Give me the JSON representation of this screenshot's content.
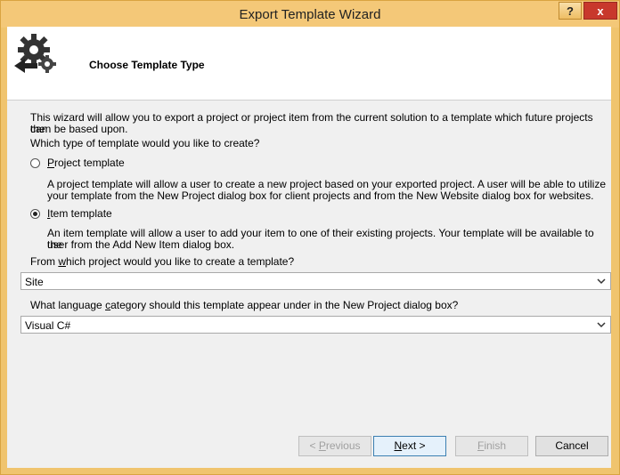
{
  "window": {
    "title": "Export Template Wizard",
    "help_label": "?",
    "close_label": "x"
  },
  "header": {
    "title": "Choose Template Type",
    "icon": "gears-export-icon"
  },
  "intro": {
    "line1": "This wizard will allow you to export a project or project item from the current solution to a template which future projects can",
    "line2": "then be based upon.",
    "question": "Which type of template would you like to create?"
  },
  "project_template": {
    "label_prefix": "",
    "label_accel": "P",
    "label_rest": "roject template",
    "selected": false,
    "desc_line1": "A project template will allow a user to create a new project based on your exported project. A user will be able to utilize",
    "desc_line2": "your template from the New Project dialog box for client projects and from the New Website dialog box for websites."
  },
  "item_template": {
    "label_accel": "I",
    "label_rest": "tem template",
    "selected": true,
    "desc_line1": "An item template will allow a user to add your item to one of their existing projects. Your template will be available to the",
    "desc_line2": "user from the Add New Item dialog box."
  },
  "project_select": {
    "label_before": "From ",
    "label_accel": "w",
    "label_after": "hich project would you like to create a template?",
    "value": "Site"
  },
  "language_select": {
    "label_before": "What language ",
    "label_accel": "c",
    "label_after": "ategory should this template appear under in the New Project dialog box?",
    "value": "Visual C#"
  },
  "buttons": {
    "previous": {
      "before": "< ",
      "accel": "P",
      "after": "revious",
      "enabled": false
    },
    "next": {
      "before": "",
      "accel": "N",
      "after": "ext >",
      "enabled": true
    },
    "finish": {
      "before": "",
      "accel": "F",
      "after": "inish",
      "enabled": false
    },
    "cancel": {
      "label": "Cancel",
      "enabled": true
    }
  },
  "colors": {
    "frame": "#f0c46e",
    "close": "#c8382c",
    "panel": "#f0f0f0",
    "header": "#ffffff"
  }
}
